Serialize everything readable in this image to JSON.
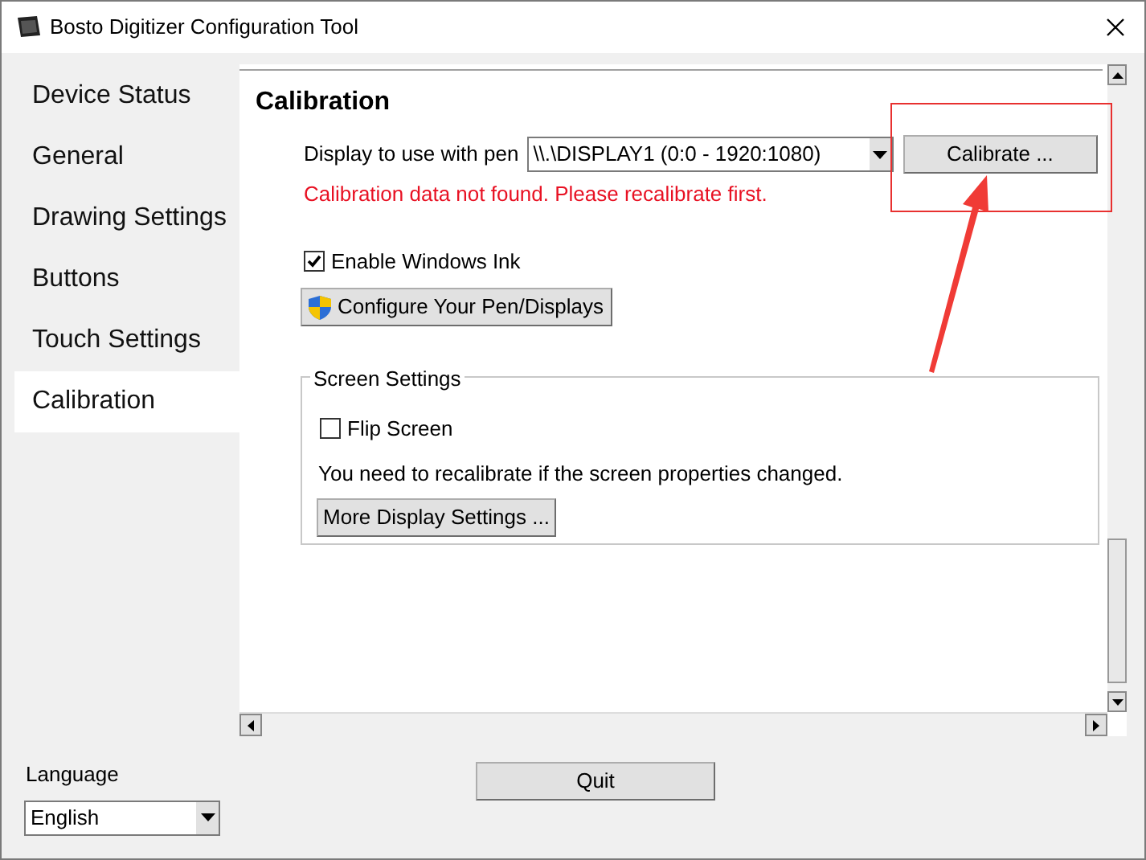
{
  "window": {
    "title": "Bosto Digitizer Configuration Tool"
  },
  "sidebar": {
    "items": [
      {
        "label": "Device Status",
        "selected": false
      },
      {
        "label": "General",
        "selected": false
      },
      {
        "label": "Drawing Settings",
        "selected": false
      },
      {
        "label": "Buttons",
        "selected": false
      },
      {
        "label": "Touch Settings",
        "selected": false
      },
      {
        "label": "Calibration",
        "selected": true
      }
    ]
  },
  "calibration": {
    "heading": "Calibration",
    "display_label": "Display to use with pen",
    "display_value": "\\\\.\\DISPLAY1 (0:0 - 1920:1080)",
    "calibrate_button": "Calibrate ...",
    "error": "Calibration data not found. Please recalibrate first.",
    "windows_ink": {
      "label": "Enable Windows Ink",
      "checked": true
    },
    "configure_button": "Configure Your Pen/Displays",
    "screen_settings": {
      "title": "Screen Settings",
      "flip_screen": {
        "label": "Flip Screen",
        "checked": false
      },
      "note": "You need to recalibrate if the screen properties changed.",
      "more_button": "More Display Settings ..."
    }
  },
  "language": {
    "label": "Language",
    "value": "English"
  },
  "quit_button": "Quit"
}
